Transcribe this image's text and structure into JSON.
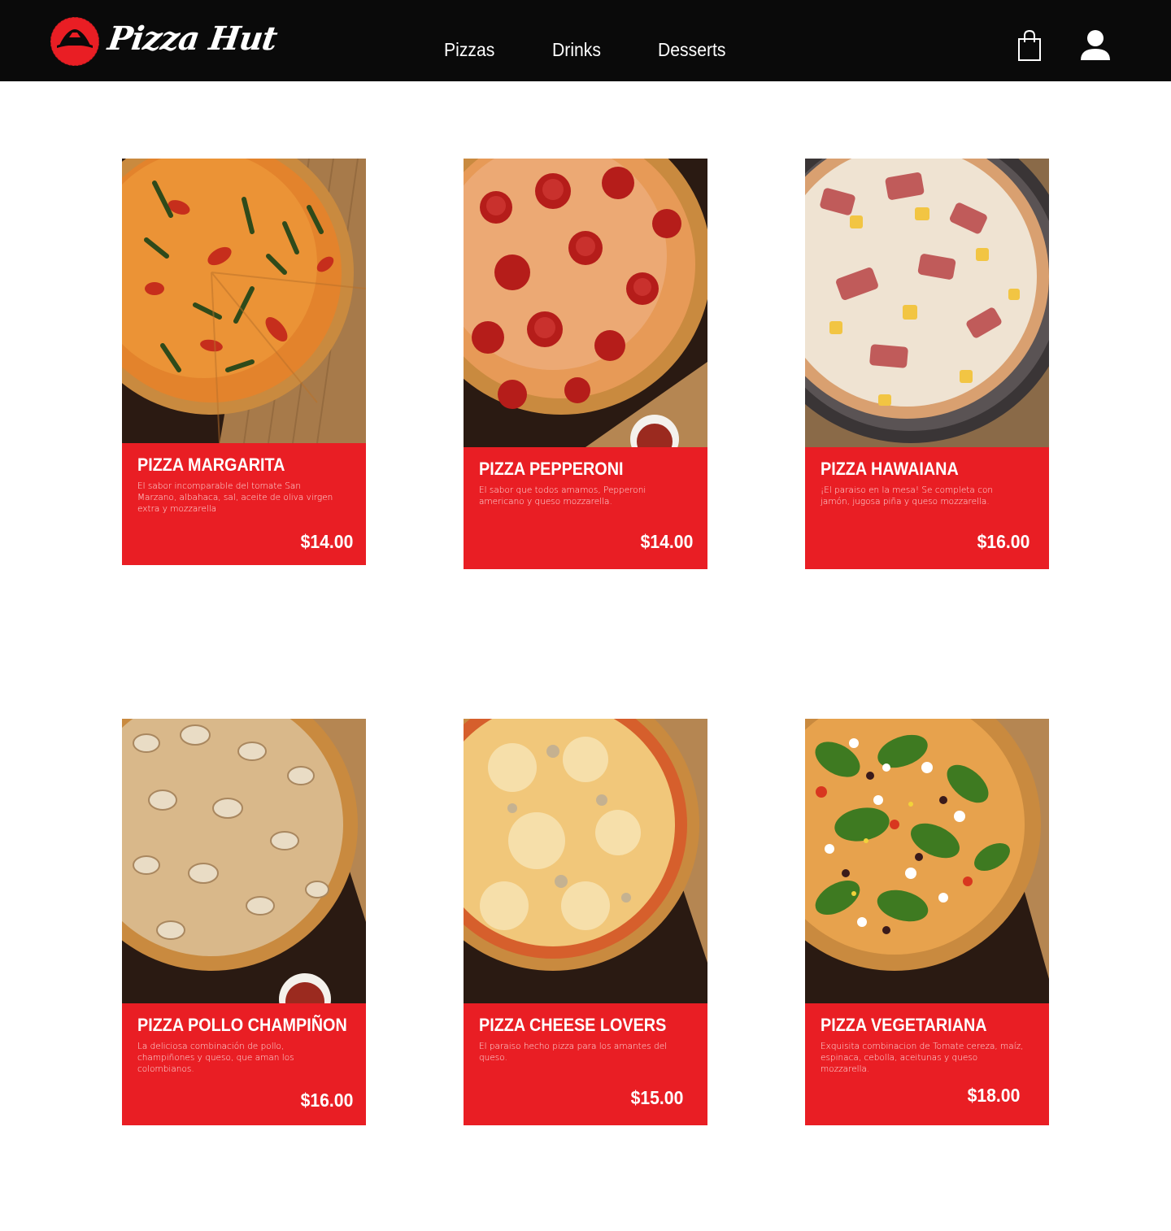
{
  "header": {
    "logo_text": "Pizza Hut",
    "nav": [
      {
        "label": "Pizzas"
      },
      {
        "label": "Drinks"
      },
      {
        "label": "Desserts"
      }
    ],
    "icons": {
      "cart": "shopping-bag-icon",
      "user": "user-icon"
    }
  },
  "colors": {
    "header_bg": "#0a0a0a",
    "brand_red": "#e91e24",
    "text_on_red": "#ffffff"
  },
  "products": [
    {
      "title": "PIZZA MARGARITA",
      "description": "El sabor incomparable del tomate San Marzano, albahaca, sal, aceite de oliva virgen extra y mozzarella",
      "price": "$14.00",
      "image": "margarita-pizza-photo"
    },
    {
      "title": "PIZZA PEPPERONI",
      "description": "El sabor que todos amamos, Pepperoni americano y queso mozzarella.",
      "price": "$14.00",
      "image": "pepperoni-pizza-photo"
    },
    {
      "title": "PIZZA HAWAIANA",
      "description": "¡El paraiso en la mesa! Se completa con jamón, jugosa piña y queso mozzarella.",
      "price": "$16.00",
      "image": "hawaiian-pizza-photo"
    },
    {
      "title": "PIZZA POLLO CHAMPIÑON",
      "description": "La deliciosa combinación de pollo, champiñones y queso, que aman los colombianos.",
      "price": "$16.00",
      "image": "chicken-mushroom-pizza-photo"
    },
    {
      "title": "PIZZA CHEESE LOVERS",
      "description": "El paraiso hecho pizza para los amantes del queso.",
      "price": "$15.00",
      "image": "cheese-pizza-photo"
    },
    {
      "title": "PIZZA VEGETARIANA",
      "description": "Exquisita combinacion de Tomate cereza, maíz, espinaca, cebolla, aceitunas y queso mozzarella.",
      "price": "$18.00",
      "image": "vegetarian-pizza-photo"
    }
  ]
}
